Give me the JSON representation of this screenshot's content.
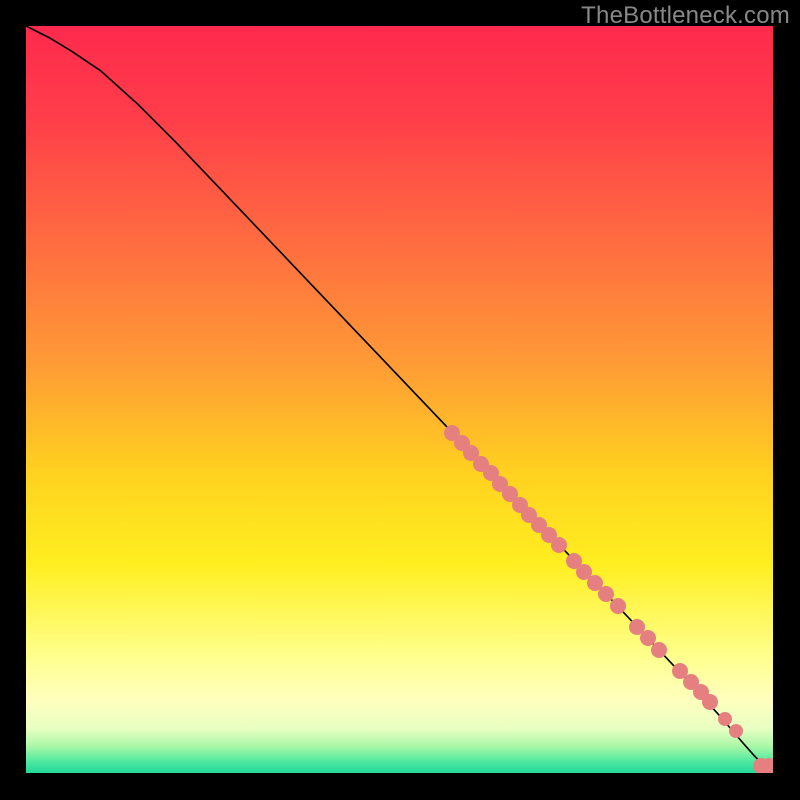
{
  "watermark": "TheBottleneck.com",
  "chart_data": {
    "type": "line",
    "title": "",
    "xlabel": "",
    "ylabel": "",
    "xlim": [
      0,
      100
    ],
    "ylim": [
      0,
      100
    ],
    "gradient_stops": [
      {
        "offset": 0.0,
        "color": "#ff2a4d"
      },
      {
        "offset": 0.12,
        "color": "#ff3d4a"
      },
      {
        "offset": 0.3,
        "color": "#ff6f40"
      },
      {
        "offset": 0.45,
        "color": "#ff9a36"
      },
      {
        "offset": 0.6,
        "color": "#ffd21f"
      },
      {
        "offset": 0.72,
        "color": "#ffee20"
      },
      {
        "offset": 0.84,
        "color": "#ffff8a"
      },
      {
        "offset": 0.9,
        "color": "#ffffbd"
      },
      {
        "offset": 0.94,
        "color": "#e9ffc2"
      },
      {
        "offset": 0.965,
        "color": "#a7f7a7"
      },
      {
        "offset": 0.985,
        "color": "#4de8a0"
      },
      {
        "offset": 1.0,
        "color": "#23d99a"
      }
    ],
    "series": [
      {
        "name": "curve",
        "x": [
          0,
          3,
          6,
          10,
          15,
          20,
          30,
          40,
          50,
          60,
          70,
          80,
          88,
          93,
          96,
          97.5,
          98.5,
          99.2,
          100
        ],
        "y": [
          100,
          98.5,
          96.7,
          94.0,
          89.5,
          84.5,
          74.0,
          63.5,
          53.0,
          42.5,
          32.0,
          21.5,
          13.0,
          7.5,
          4.0,
          2.3,
          1.3,
          0.9,
          0.9
        ]
      }
    ],
    "dots": {
      "name": "highlight-points",
      "color": "#e68080",
      "points": [
        {
          "x": 57.0,
          "y": 45.5,
          "r": 8
        },
        {
          "x": 58.3,
          "y": 44.2,
          "r": 8
        },
        {
          "x": 59.6,
          "y": 42.8,
          "r": 8
        },
        {
          "x": 60.9,
          "y": 41.4,
          "r": 8
        },
        {
          "x": 62.2,
          "y": 40.1,
          "r": 8
        },
        {
          "x": 63.5,
          "y": 38.7,
          "r": 8
        },
        {
          "x": 64.8,
          "y": 37.3,
          "r": 8
        },
        {
          "x": 66.1,
          "y": 35.9,
          "r": 8
        },
        {
          "x": 67.4,
          "y": 34.6,
          "r": 8
        },
        {
          "x": 68.7,
          "y": 33.2,
          "r": 8
        },
        {
          "x": 70.0,
          "y": 31.8,
          "r": 8
        },
        {
          "x": 71.3,
          "y": 30.5,
          "r": 8
        },
        {
          "x": 73.3,
          "y": 28.4,
          "r": 8
        },
        {
          "x": 74.7,
          "y": 26.9,
          "r": 8
        },
        {
          "x": 76.2,
          "y": 25.4,
          "r": 8
        },
        {
          "x": 77.7,
          "y": 23.9,
          "r": 8
        },
        {
          "x": 79.2,
          "y": 22.3,
          "r": 8
        },
        {
          "x": 81.8,
          "y": 19.6,
          "r": 8
        },
        {
          "x": 83.3,
          "y": 18.1,
          "r": 8
        },
        {
          "x": 84.8,
          "y": 16.5,
          "r": 8
        },
        {
          "x": 87.5,
          "y": 13.7,
          "r": 8
        },
        {
          "x": 89.0,
          "y": 12.2,
          "r": 8
        },
        {
          "x": 90.3,
          "y": 10.8,
          "r": 8
        },
        {
          "x": 91.5,
          "y": 9.5,
          "r": 8
        },
        {
          "x": 93.6,
          "y": 7.2,
          "r": 7
        },
        {
          "x": 95.0,
          "y": 5.6,
          "r": 7
        },
        {
          "x": 98.4,
          "y": 1.0,
          "r": 8
        },
        {
          "x": 99.5,
          "y": 0.9,
          "r": 8
        }
      ]
    }
  }
}
